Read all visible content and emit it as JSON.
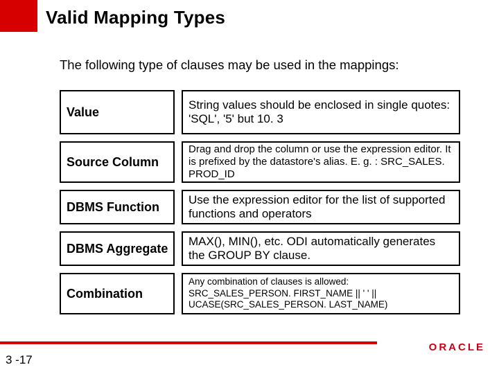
{
  "title": "Valid Mapping Types",
  "intro": "The following type of clauses may be used in the mappings:",
  "rows": {
    "value": {
      "label": "Value",
      "desc": "String values should be enclosed in single quotes:\n'SQL', '5' but 10. 3"
    },
    "source": {
      "label": "Source Column",
      "desc": "Drag and drop the column or use the expression editor. It is prefixed by the datastore's alias. E. g. : SRC_SALES. PROD_ID"
    },
    "dbmsfunc": {
      "label": "DBMS Function",
      "desc": "Use the expression editor for the list of supported functions and operators"
    },
    "dbmsagg": {
      "label": "DBMS Aggregate",
      "desc": "MAX(), MIN(), etc. ODI automatically generates the GROUP BY clause."
    },
    "combo": {
      "label": "Combination",
      "desc": "Any combination of clauses is allowed:\nSRC_SALES_PERSON. FIRST_NAME || ' ' || UCASE(SRC_SALES_PERSON. LAST_NAME)"
    }
  },
  "slideNum": "3 -17",
  "logo": "ORACLE"
}
